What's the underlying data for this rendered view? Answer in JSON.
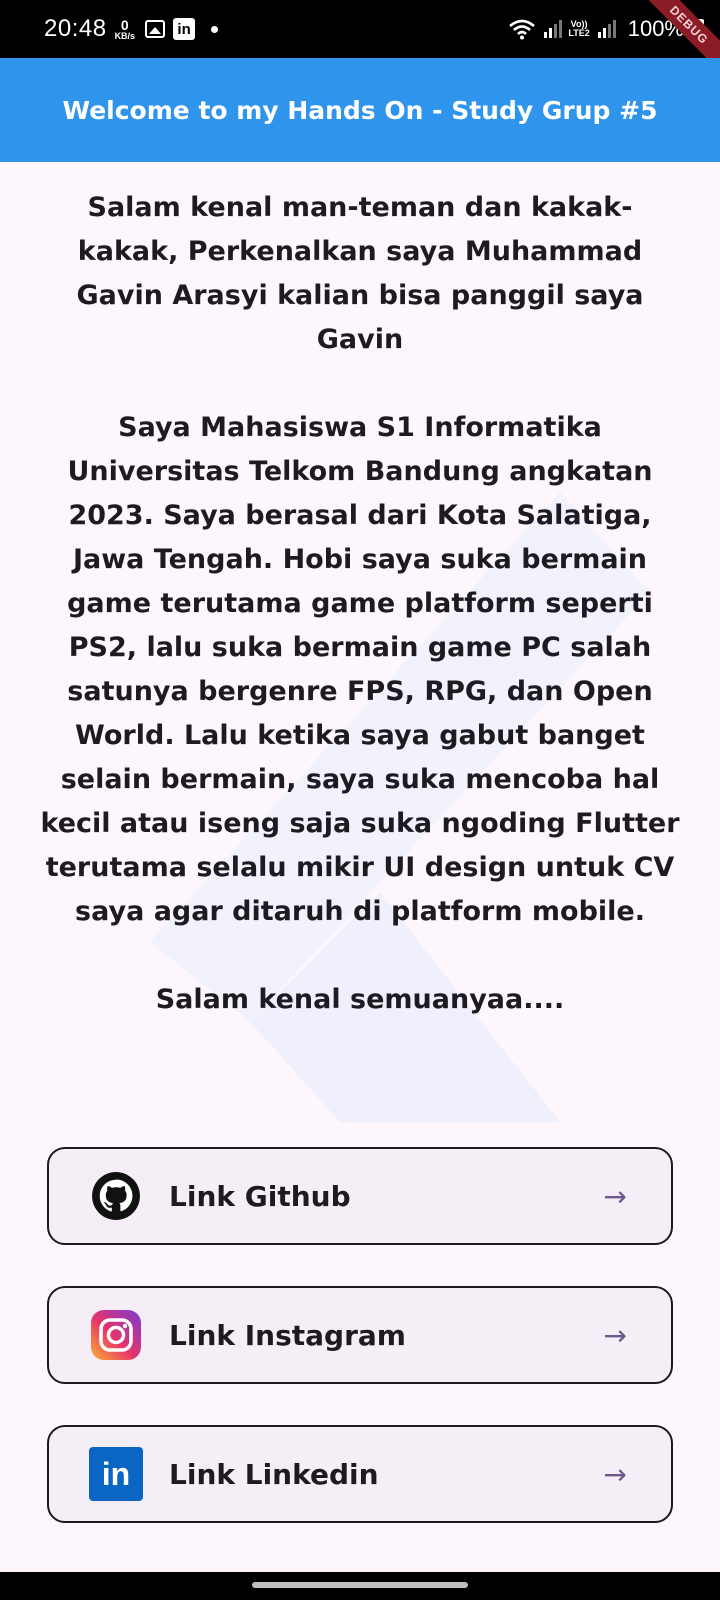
{
  "status_bar": {
    "time": "20:48",
    "net_speed": "0",
    "net_unit": "KB/s",
    "lte_line1": "Vo))",
    "lte_line2": "LTE2",
    "battery": "100%",
    "icons": [
      "gallery-icon",
      "linkedin-icon",
      "wifi-icon",
      "signal-icon",
      "battery-icon"
    ]
  },
  "debug_banner": "DEBUG",
  "app_bar": {
    "title": "Welcome to my Hands On - Study Grup #5",
    "color": "#2f94ec"
  },
  "intro": {
    "paragraph1": "Salam kenal man-teman dan kakak-kakak, Perkenalkan saya Muhammad Gavin Arasyi kalian bisa panggil saya Gavin",
    "paragraph2": "Saya Mahasiswa S1 Informatika Universitas Telkom Bandung angkatan 2023. Saya berasal dari Kota Salatiga, Jawa Tengah. Hobi saya suka bermain game terutama game platform seperti PS2, lalu suka bermain game PC salah satunya bergenre FPS, RPG, dan Open World. Lalu ketika saya gabut banget selain bermain, saya suka mencoba hal kecil atau iseng saja suka ngoding Flutter terutama selalu mikir UI design untuk CV saya agar ditaruh di platform mobile.",
    "closing": "Salam kenal semuanyaa...."
  },
  "links": [
    {
      "label": "Link Github",
      "icon": "github-icon",
      "arrow": "→"
    },
    {
      "label": "Link Instagram",
      "icon": "instagram-icon",
      "arrow": "→"
    },
    {
      "label": "Link Linkedin",
      "icon": "linkedin-icon",
      "icon_text": "in",
      "arrow": "→"
    }
  ]
}
